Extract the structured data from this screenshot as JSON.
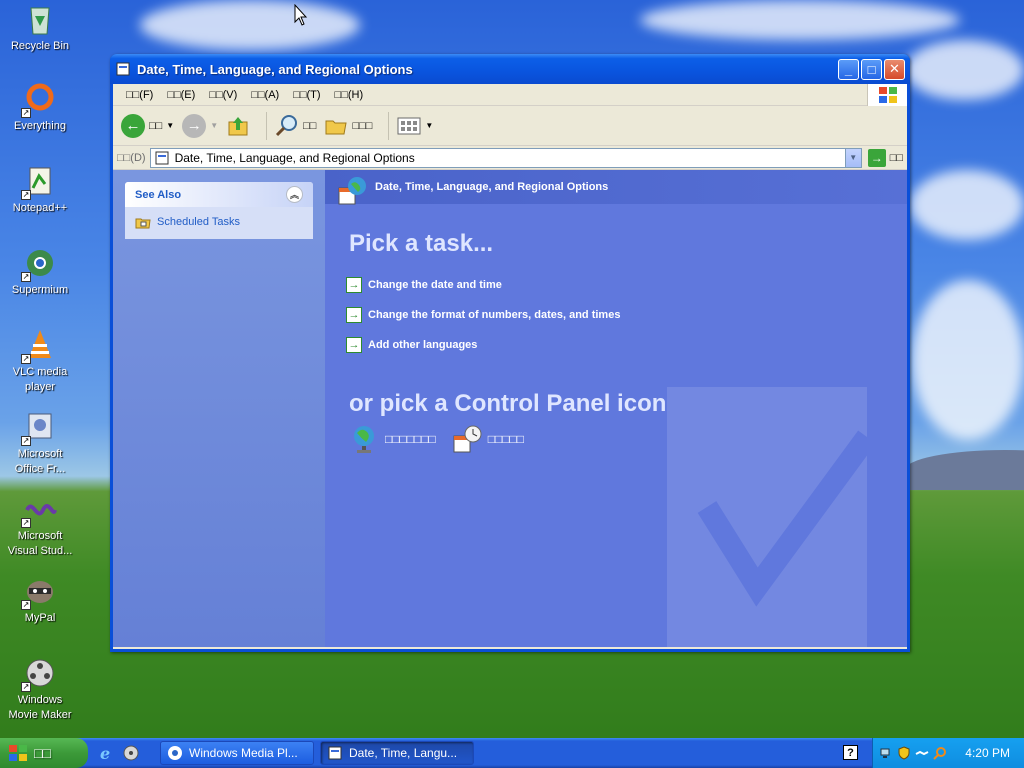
{
  "desktop": {
    "icons": [
      {
        "label": "Recycle Bin"
      },
      {
        "label": "Everything"
      },
      {
        "label": "Notepad++"
      },
      {
        "label": "Supermium"
      },
      {
        "label": "VLC media player"
      },
      {
        "label": "Microsoft Office Fr..."
      },
      {
        "label": "Microsoft Visual Stud..."
      },
      {
        "label": "MyPal"
      },
      {
        "label": "Windows Movie Maker"
      }
    ]
  },
  "window": {
    "title": "Date, Time, Language, and Regional Options",
    "menu": [
      "□□(F)",
      "□□(E)",
      "□□(V)",
      "□□(A)",
      "□□(T)",
      "□□(H)"
    ],
    "toolbar": {
      "back_label": "□□",
      "search_label": "□□",
      "folders_label": "□□□"
    },
    "address": {
      "label": "□□(D)",
      "value": "Date, Time, Language, and Regional Options",
      "go_label": "□□"
    },
    "see_also": {
      "title": "See Also",
      "items": [
        {
          "label": "Scheduled Tasks"
        }
      ]
    },
    "banner_title": "Date, Time, Language, and Regional Options",
    "pick_task": "Pick a task...",
    "tasks": [
      {
        "label": "Change the date and time"
      },
      {
        "label": "Change the format of numbers, dates, and times"
      },
      {
        "label": "Add other languages"
      }
    ],
    "pick_icon": "or pick a Control Panel icon",
    "cp_icons": [
      {
        "label": "□□□□□□□"
      },
      {
        "label": "□□□□□"
      }
    ]
  },
  "taskbar": {
    "start_label": "□□",
    "buttons": [
      {
        "label": "Windows Media Pl..."
      },
      {
        "label": "Date, Time, Langu..."
      }
    ],
    "help_label": "?",
    "clock": "4:20 PM"
  }
}
